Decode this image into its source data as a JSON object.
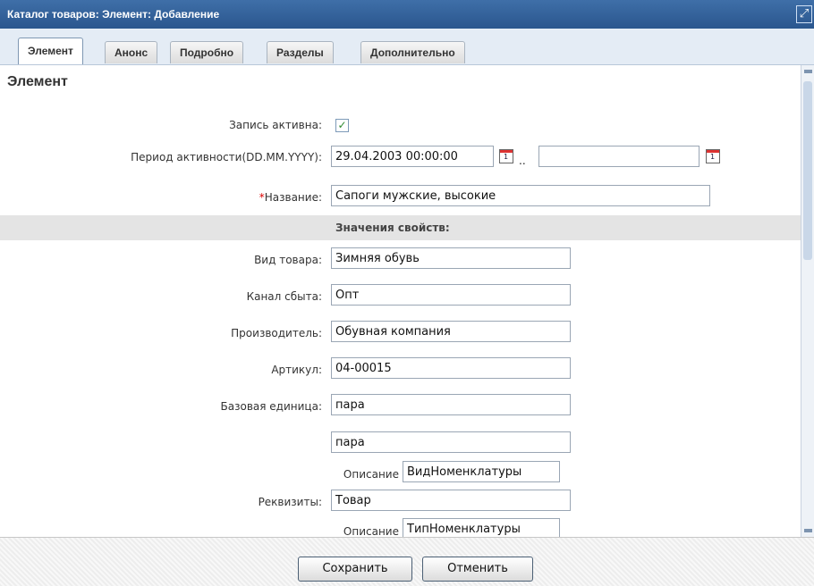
{
  "window": {
    "title": "Каталог товаров: Элемент: Добавление",
    "resize_icon": "window-resize-icon"
  },
  "tabs": [
    {
      "label": "Элемент",
      "active": true
    },
    {
      "label": "Анонс",
      "active": false
    },
    {
      "label": "Подробно",
      "active": false
    },
    {
      "label": "Разделы",
      "active": false
    },
    {
      "label": "Дополнительно",
      "active": false
    }
  ],
  "section": {
    "title": "Элемент"
  },
  "form": {
    "active": {
      "label": "Запись активна:",
      "checked": true,
      "check_glyph": "✓"
    },
    "period": {
      "label": "Период активности(DD.MM.YYYY):",
      "from": "29.04.2003 00:00:00",
      "to": "",
      "separator": "..",
      "calendar_icon": "calendar-icon",
      "calendar_glyph": "1"
    },
    "name": {
      "required_mark": "*",
      "label": "Название:",
      "value": "Сапоги мужские, высокие"
    },
    "props_header": "Значения свойств:",
    "props": {
      "vid": {
        "label": "Вид товара:",
        "value": "Зимняя обувь"
      },
      "kanal": {
        "label": "Канал сбыта:",
        "value": "Опт"
      },
      "proizv": {
        "label": "Производитель:",
        "value": "Обувная компания"
      },
      "artikul": {
        "label": "Артикул:",
        "value": "04-00015"
      },
      "bazov": {
        "label": "Базовая единица:",
        "value": "пара",
        "value2": "пара"
      },
      "opisanie_label": "Описание",
      "opisanie_value": "ВидНоменклатуры",
      "rekvizity": {
        "label": "Реквизиты:",
        "value": "Товар"
      },
      "opisanie2_label": "Описание",
      "opisanie2_value": "ТипНоменклатуры"
    }
  },
  "buttons": {
    "save": "Сохранить",
    "cancel": "Отменить"
  },
  "colors": {
    "titlebar": "#2f5d96",
    "tabsbar": "#e4ecf5",
    "separator": "#e4e4e4"
  }
}
